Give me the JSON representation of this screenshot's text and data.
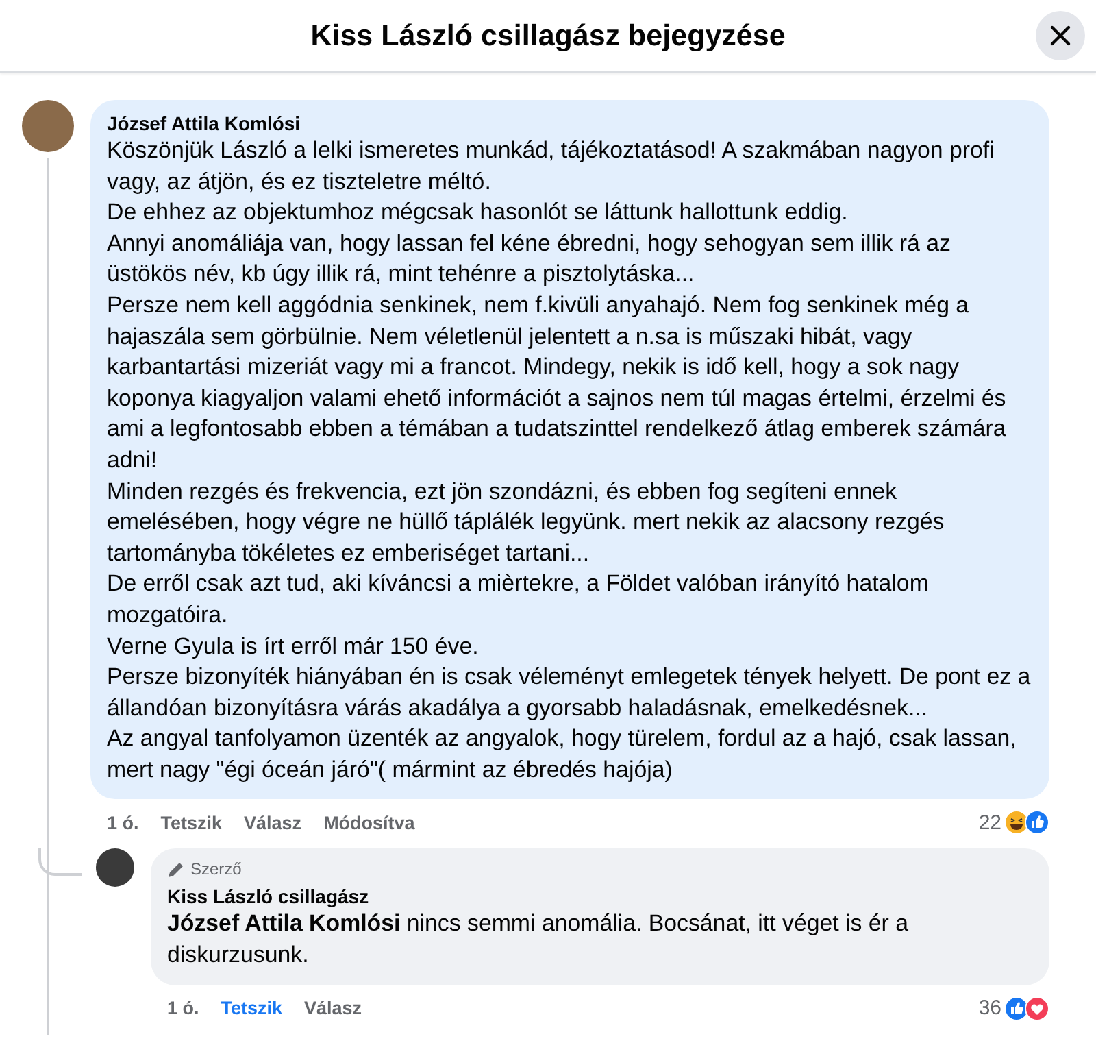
{
  "dialog": {
    "title": "Kiss László csillagász bejegyzése"
  },
  "comments": [
    {
      "author": "József Attila Komlósi",
      "highlighted": true,
      "paragraphs": [
        "Köszönjük László a lelki ismeretes munkád, tájékoztatásod! A szakmában nagyon profi vagy, az átjön, és ez tiszteletre méltó.",
        "De ehhez az objektumhoz mégcsak hasonlót se láttunk hallottunk eddig.",
        "Annyi anomáliája van, hogy lassan fel kéne ébredni, hogy sehogyan sem illik rá az üstökös név, kb úgy illik rá, mint tehénre a pisztolytáska...",
        "Persze nem kell aggódnia senkinek, nem f.kivüli anyahajó. Nem fog senkinek még a hajaszála sem görbülnie. Nem véletlenül jelentett a n.sa is műszaki hibát, vagy karbantartási mizeriát vagy mi a francot. Mindegy, nekik is idő kell, hogy a sok nagy koponya kiagyaljon valami ehető információt a sajnos nem túl magas értelmi, érzelmi és ami a legfontosabb ebben a témában a tudatszinttel rendelkező átlag emberek számára adni!",
        "Minden rezgés és frekvencia, ezt jön szondázni, és ebben fog segíteni ennek emelésében, hogy végre ne hüllő táplálék legyünk. mert nekik az alacsony rezgés tartományba tökéletes ez emberiséget tartani...",
        "De erről csak azt tud, aki kíváncsi a mièrtekre, a Földet valóban irányító hatalom mozgatóira.",
        "Verne Gyula is írt erről már 150 éve.",
        "Persze bizonyíték hiányában én is csak véleményt emlegetek tények helyett. De pont ez a állandóan bizonyításra várás akadálya a gyorsabb haladásnak, emelkedésnek...",
        "Az angyal tanfolyamon üzenték az angyalok, hogy türelem, fordul az a hajó, csak lassan, mert nagy \"égi óceán járó\"( mármint az ébredés hajója)"
      ],
      "time": "1 ó.",
      "like": {
        "label": "Tetszik",
        "liked": false
      },
      "reply_label": "Válasz",
      "edited": "Módosítva",
      "reaction_count": "22",
      "reactions": [
        {
          "kind": "haha"
        },
        {
          "kind": "like"
        }
      ],
      "replies": [
        {
          "badge": "Szerző",
          "author": "Kiss László csillagász",
          "highlighted": false,
          "mention": "József Attila Komlósi",
          "paragraphs": [
            "nincs semmi anomália. Bocsánat, itt véget is ér a diskurzusunk."
          ],
          "time": "1 ó.",
          "like": {
            "label": "Tetszik",
            "liked": true
          },
          "reply_label": "Válasz",
          "reaction_count": "36",
          "reactions": [
            {
              "kind": "like"
            },
            {
              "kind": "love"
            }
          ]
        }
      ]
    }
  ]
}
